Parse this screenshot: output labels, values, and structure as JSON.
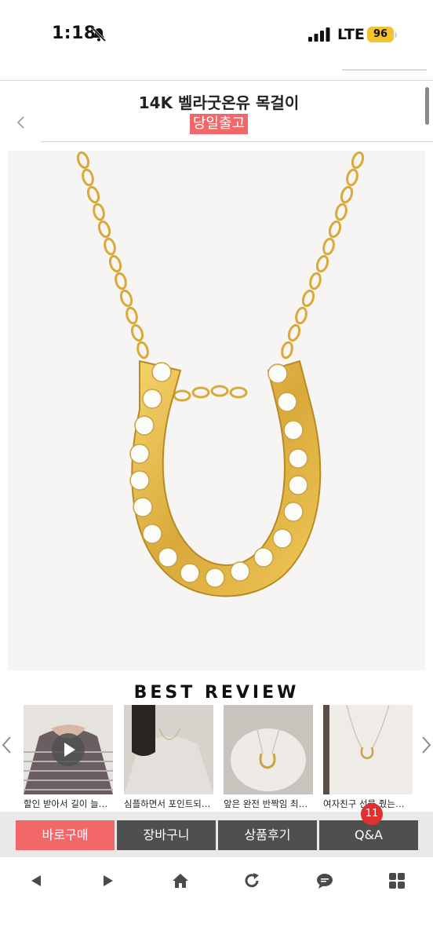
{
  "status_bar": {
    "time": "1:18",
    "network": "LTE",
    "battery": "96",
    "mute_icon": "bell-slash-icon",
    "signal_icon": "signal-bars-icon"
  },
  "header": {
    "title": "14K 벨라굿온유 목걸이",
    "badge": "당일출고",
    "back_icon": "chevron-left-icon",
    "badge_color": "#f2676a"
  },
  "product": {
    "image": "horseshoe-necklace-image"
  },
  "best_review": {
    "title": "BEST REVIEW",
    "items": [
      {
        "caption": "할인 받아서 길이 늘리…",
        "has_video": true
      },
      {
        "caption": "심플하면서 포인트되…",
        "has_video": false
      },
      {
        "caption": "앞은 완전 반짝임 최대…",
        "has_video": false
      },
      {
        "caption": "여자친구 선물 줬는데 …",
        "has_video": false
      }
    ]
  },
  "actions": {
    "buy_now": "바로구매",
    "cart": "장바구니",
    "reviews": "상품후기",
    "qa": "Q&A",
    "qa_count": "11",
    "primary_color": "#f2676a",
    "secondary_color": "#4f4f4f"
  },
  "browser_toolbar": {
    "icons": [
      "back-arrow-icon",
      "forward-arrow-icon",
      "home-icon",
      "refresh-icon",
      "chat-icon",
      "grid-icon"
    ]
  }
}
